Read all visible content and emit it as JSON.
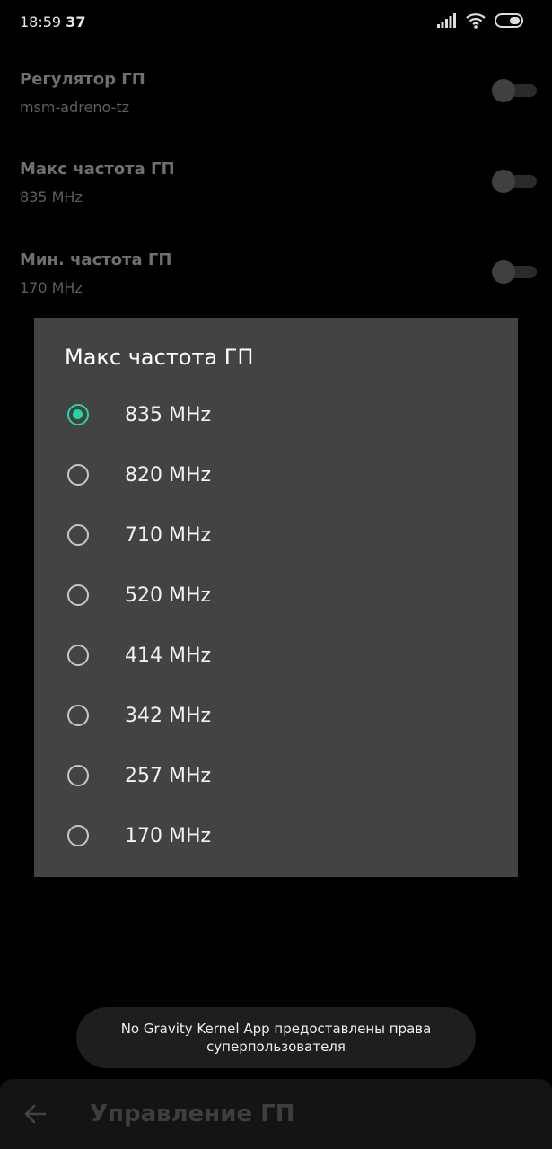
{
  "status_bar": {
    "time": "18:59",
    "seconds": "37"
  },
  "settings": [
    {
      "title": "Регулятор ГП",
      "value": "msm-adreno-tz",
      "enabled": false
    },
    {
      "title": "Макс частота ГП",
      "value": "835 MHz",
      "enabled": false
    },
    {
      "title": "Мин. частота ГП",
      "value": "170 MHz",
      "enabled": false
    }
  ],
  "dialog": {
    "title": "Макс частота ГП",
    "selected": "835 MHz",
    "options": [
      "835 MHz",
      "820 MHz",
      "710 MHz",
      "520 MHz",
      "414 MHz",
      "342 MHz",
      "257 MHz",
      "170 MHz"
    ]
  },
  "toast": {
    "text": "No Gravity Kernel App предоставлены права суперпользователя"
  },
  "app_bar": {
    "title": "Управление ГП",
    "back_icon": "arrow-left-icon"
  },
  "colors": {
    "accent": "#25d5a6",
    "dialog_bg": "#434343",
    "background": "#000000"
  }
}
